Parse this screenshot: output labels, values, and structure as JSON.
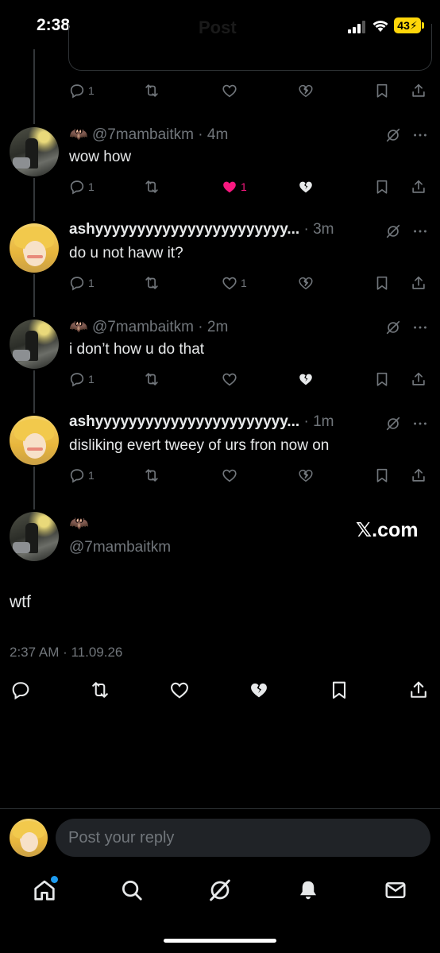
{
  "status_bar": {
    "time": "2:38",
    "ghost_title": "Post",
    "battery": "43"
  },
  "replies": [
    {
      "type": "stub",
      "counts": {
        "reply": "1",
        "repost": "",
        "like": "",
        "dislike": ""
      }
    },
    {
      "avatar": "mamba",
      "name": "",
      "emoji": "🦇",
      "handle": "@7mambaitkm",
      "time": "4m",
      "text": "wow how",
      "counts": {
        "reply": "1",
        "repost": "",
        "like": "1"
      },
      "liked": true,
      "disliked": true
    },
    {
      "avatar": "ash",
      "name": "ashyyyyyyyyyyyyyyyyyyyyyyy...",
      "handle": "",
      "time": "3m",
      "text": "do u not havw it?",
      "counts": {
        "reply": "1",
        "repost": "",
        "like": "1"
      },
      "liked": false,
      "disliked": false
    },
    {
      "avatar": "mamba",
      "name": "",
      "emoji": "🦇",
      "handle": "@7mambaitkm",
      "time": "2m",
      "text": "i don’t how u do that",
      "counts": {
        "reply": "1",
        "repost": "",
        "like": ""
      },
      "liked": false,
      "disliked": true
    },
    {
      "avatar": "ash",
      "name": "ashyyyyyyyyyyyyyyyyyyyyyyy...",
      "handle": "",
      "time": "1m",
      "text": "disliking evert tweey of urs fron now on",
      "counts": {
        "reply": "1",
        "repost": "",
        "like": ""
      },
      "liked": false,
      "disliked": false
    }
  ],
  "main_post": {
    "emoji": "🦇",
    "handle": "@7mambaitkm",
    "watermark": "𝕏.com",
    "text": "wtf",
    "timestamp": "2:37 AM · 11.09.26"
  },
  "reply_box": {
    "placeholder": "Post your reply"
  },
  "nav": [
    "home-icon",
    "search-icon",
    "grok-icon",
    "notifications-icon",
    "messages-icon"
  ],
  "colors": {
    "accent": "#1d9bf0",
    "like": "#f91880",
    "muted": "#71767b",
    "text": "#e7e9ea",
    "battery": "#ffd60a"
  }
}
